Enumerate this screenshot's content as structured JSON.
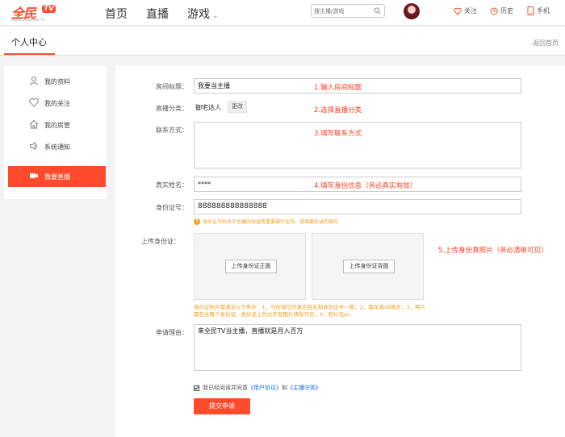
{
  "header": {
    "logo_main": "全民",
    "logo_tv": "TV",
    "logo_sub": "WWW.QUANMIN.TV",
    "nav": [
      "首页",
      "直播",
      "游戏"
    ],
    "search_placeholder": "搜主播/游戏",
    "username": "...",
    "follow_label": "关注",
    "history_label": "历史",
    "mobile_label": "手机",
    "accent_color": "#ff4b2b"
  },
  "title_bar": {
    "title": "个人中心",
    "back_home": "返回首页"
  },
  "sidebar": {
    "items": [
      {
        "label": "我的资料",
        "icon": "user-icon"
      },
      {
        "label": "我的关注",
        "icon": "heart-icon"
      },
      {
        "label": "我的房管",
        "icon": "home-icon"
      },
      {
        "label": "系统通知",
        "icon": "speaker-icon"
      },
      {
        "label": "我要直播",
        "icon": "camera-icon",
        "active": true
      }
    ]
  },
  "form": {
    "room_title_label": "房间标题：",
    "room_title_value": "我要当主播",
    "room_title_hint": "1.输入房间标题",
    "category_label": "直播分类：",
    "category_value": "御宅达人",
    "category_change": "更改",
    "category_hint": "2.选择直播分类",
    "contact_label": "联系方式：",
    "contact_hint": "3.填写联系方式",
    "realname_label": "真实姓名：",
    "realname_value": "****",
    "realname_hint": "4.填写身份信息（务必真实有效）",
    "id_label": "身份证号：",
    "id_value": "888888888888888",
    "id_warning": "身份证号码关于主播的收益等重要操作挂钩，请准确无误的填写",
    "upload_label": "上传身份证：",
    "upload_front": "上传身份证正面",
    "upload_back": "上传身份证背面",
    "upload_hint": "5.上传身份真照片（务必清晰可见）",
    "upload_notes": "身份证照片需满足以下条件：1，与所填写的真实姓名和身份证号一致；2，需年满18周岁；3，照片需包含整个身份证，身份证上的文字及图片清晰可见；4，照片无ps",
    "reason_label": "申请理由：",
    "reason_value": "来全民TV当主播，直播就是月入百万",
    "agree_prefix": "我已经阅读并同意",
    "agree_link1": "《用户协议》",
    "agree_and": "和",
    "agree_link2": "《主播守则》",
    "submit_label": "提交申请"
  }
}
